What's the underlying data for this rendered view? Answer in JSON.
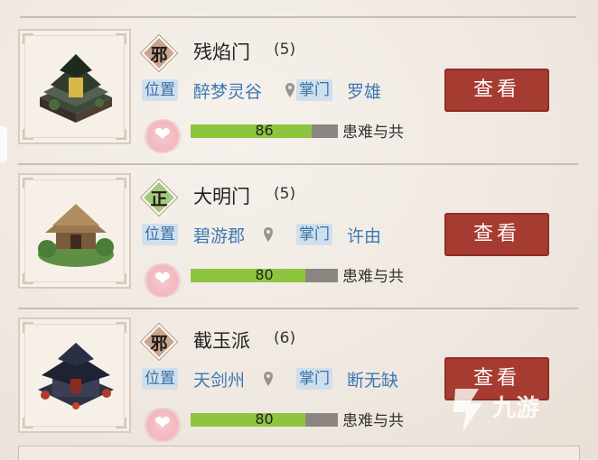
{
  "sects": [
    {
      "alignment": "邪",
      "alignment_color": "#c9a58d",
      "name": "残焰门",
      "count": "(5)",
      "location_label": "位置",
      "location": "醉梦灵谷",
      "leader_label": "掌门",
      "leader": "罗雄",
      "relation_value": "86",
      "relation_fraction": 0.86,
      "relation_text": "患难与共",
      "view_button": "查看"
    },
    {
      "alignment": "正",
      "alignment_color": "#a3c97d",
      "name": "大明门",
      "count": "(5)",
      "location_label": "位置",
      "location": "碧游郡",
      "leader_label": "掌门",
      "leader": "许由",
      "relation_value": "80",
      "relation_fraction": 0.8,
      "relation_text": "患难与共",
      "view_button": "查看"
    },
    {
      "alignment": "邪",
      "alignment_color": "#c9a58d",
      "name": "截玉派",
      "count": "(6)",
      "location_label": "位置",
      "location": "天剑州",
      "leader_label": "掌门",
      "leader": "断无缺",
      "relation_value": "80",
      "relation_fraction": 0.8,
      "relation_text": "患难与共",
      "view_button": "查看"
    }
  ],
  "watermark": "九游",
  "colors": {
    "button": "#a63b31",
    "bar_fill": "#8cc63f",
    "bar_track": "#8b8581",
    "tag_bg": "#cfe0ec",
    "tag_text": "#3b6fa6"
  }
}
